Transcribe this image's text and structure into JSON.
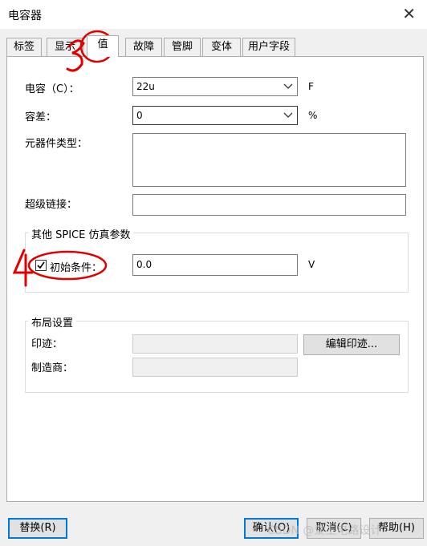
{
  "window": {
    "title": "电容器",
    "close_glyph": "✕"
  },
  "tabs": [
    {
      "label": "标签"
    },
    {
      "label": "显示"
    },
    {
      "label": "值",
      "active": true
    },
    {
      "label": "故障"
    },
    {
      "label": "管脚"
    },
    {
      "label": "变体"
    },
    {
      "label": "用户字段"
    }
  ],
  "form": {
    "capacitance": {
      "label": "电容（C）：",
      "value": "22u",
      "unit": "F"
    },
    "tolerance": {
      "label": "容差：",
      "value": "0",
      "unit": "%"
    },
    "component_type": {
      "label": "元器件类型：",
      "value": ""
    },
    "hyperlink": {
      "label": "超级链接：",
      "value": ""
    }
  },
  "spice": {
    "group_title": "其他 SPICE 仿真参数",
    "initial_condition": {
      "label": "初始条件：",
      "checked": true,
      "value": "0.0",
      "unit": "V"
    }
  },
  "layout_settings": {
    "group_title": "布局设置",
    "footprint_label": "印迹：",
    "footprint_value": "",
    "edit_footprint_button": "编辑印迹...",
    "manufacturer_label": "制造商：",
    "manufacturer_value": ""
  },
  "buttons": {
    "replace": "替换(R)",
    "ok": "确认(O)",
    "cancel": "取消(C)",
    "help": "帮助(H)"
  },
  "annotations": {
    "tab_mark": "3",
    "checkbox_mark": "4"
  },
  "watermark": "CSDN @爱上电路设计",
  "colors": {
    "accent": "#0078d7",
    "annotation": "#e00000"
  },
  "icons": [
    "close-icon",
    "chevron-down-icon",
    "checkmark-icon"
  ]
}
